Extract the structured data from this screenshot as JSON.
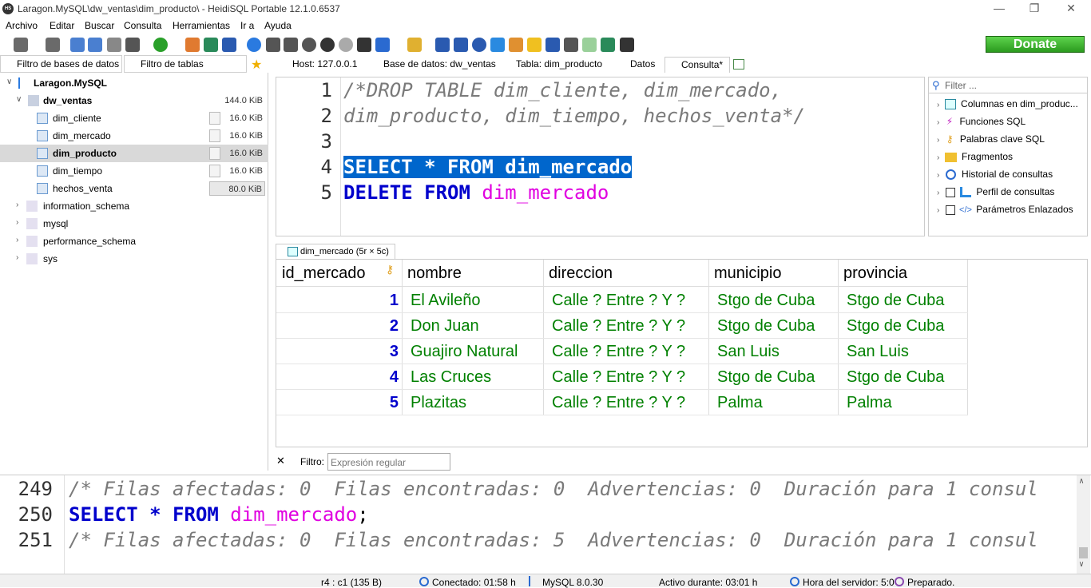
{
  "window": {
    "title": "Laragon.MySQL\\dw_ventas\\dim_producto\\ - HeidiSQL Portable 12.1.0.6537",
    "app_icon": "HS"
  },
  "menu": [
    "Archivo",
    "Editar",
    "Buscar",
    "Consulta",
    "Herramientas",
    "Ir a",
    "Ayuda"
  ],
  "toolbar": {
    "donate": "Donate"
  },
  "filters": {
    "db_filter": "Filtro de bases de datos",
    "table_filter": "Filtro de tablas"
  },
  "tabs": [
    "Host: 127.0.0.1",
    "Base de datos: dw_ventas",
    "Tabla: dim_producto",
    "Datos",
    "Consulta*"
  ],
  "tree": {
    "root": "Laragon.MySQL",
    "db": "dw_ventas",
    "db_size": "144.0 KiB",
    "tables": [
      {
        "name": "dim_cliente",
        "size": "16.0 KiB"
      },
      {
        "name": "dim_mercado",
        "size": "16.0 KiB"
      },
      {
        "name": "dim_producto",
        "size": "16.0 KiB"
      },
      {
        "name": "dim_tiempo",
        "size": "16.0 KiB"
      },
      {
        "name": "hechos_venta",
        "size": "80.0 KiB"
      }
    ],
    "others": [
      "information_schema",
      "mysql",
      "performance_schema",
      "sys"
    ]
  },
  "editor": {
    "line_numbers": [
      "1",
      "2",
      "3",
      "4",
      "5"
    ],
    "l1": "/*DROP TABLE dim_cliente, dim_mercado,",
    "l2": "dim_producto, dim_tiempo, hechos_venta*/",
    "l4": "SELECT * FROM dim_mercado",
    "l5_kw": "DELETE FROM",
    "l5_id": "dim_mercado"
  },
  "helper": {
    "filter_placeholder": "Filter ...",
    "items": [
      "Columnas en dim_produc...",
      "Funciones SQL",
      "Palabras clave SQL",
      "Fragmentos",
      "Historial de consultas",
      "Perfil de consultas",
      "Parámetros Enlazados"
    ]
  },
  "result": {
    "tab_label": "dim_mercado (5r × 5c)",
    "columns": [
      "id_mercado",
      "nombre",
      "direccion",
      "municipio",
      "provincia"
    ],
    "rows": [
      [
        "1",
        "El Avileño",
        "Calle ? Entre ? Y ?",
        "Stgo de Cuba",
        "Stgo de Cuba"
      ],
      [
        "2",
        "Don Juan",
        "Calle ? Entre ? Y ?",
        "Stgo de Cuba",
        "Stgo de Cuba"
      ],
      [
        "3",
        "Guajiro Natural",
        "Calle ? Entre ? Y ?",
        "San Luis",
        "San Luis"
      ],
      [
        "4",
        "Las Cruces",
        "Calle ? Entre ? Y ?",
        "Stgo de Cuba",
        "Stgo de Cuba"
      ],
      [
        "5",
        "Plazitas",
        "Calle ? Entre ? Y ?",
        "Palma",
        "Palma"
      ]
    ]
  },
  "filter_row": {
    "label": "Filtro:",
    "placeholder": "Expresión regular"
  },
  "log": {
    "lines": [
      "249",
      "250",
      "251"
    ],
    "l249": "/* Filas afectadas: 0  Filas encontradas: 0  Advertencias: 0  Duración para 1 consul",
    "l250_kw": "SELECT * FROM",
    "l250_id": "dim_mercado",
    "l250_end": ";",
    "l251": "/* Filas afectadas: 0  Filas encontradas: 5  Advertencias: 0  Duración para 1 consul"
  },
  "status": {
    "pos": "r4 : c1 (135 B)",
    "connected": "Conectado: 01:58 h",
    "server": "MySQL 8.0.30",
    "uptime": "Activo durante: 03:01 h",
    "server_time": "Hora del servidor: 5:0",
    "state": "Preparado."
  },
  "colors": {
    "keyword": "#0000cc",
    "identifier": "#e000e0",
    "comment": "#7a7a7a",
    "green_text": "#008000",
    "selection": "#0066cc"
  }
}
